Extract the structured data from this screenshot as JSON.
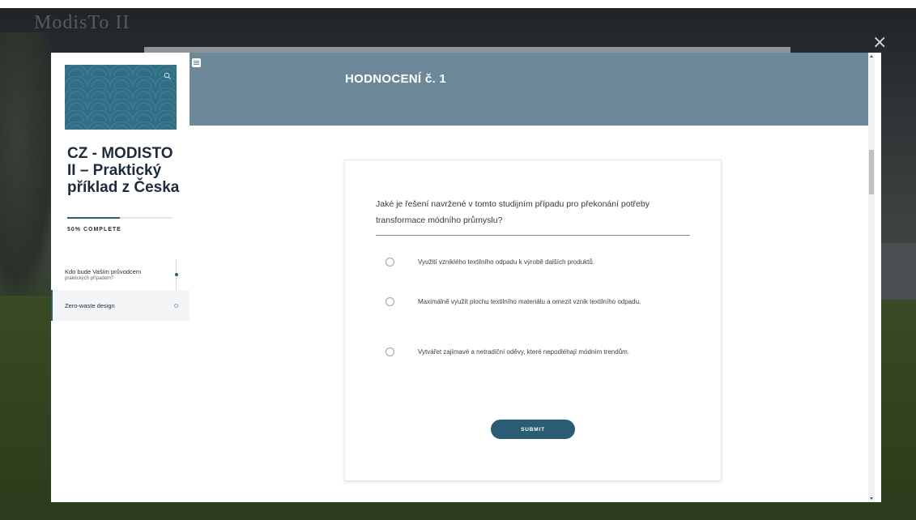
{
  "background": {
    "logo_text": "ModisTo II"
  },
  "window": {
    "close_glyph": "×"
  },
  "sidebar": {
    "course_title": "CZ - MODISTO II – Praktický příklad z Česka",
    "progress_percent": 50,
    "progress_label": "50% COMPLETE",
    "items": [
      {
        "label": "Kdo bude Vaším průvodcem",
        "sublabel": "praktických případem?",
        "status": "complete"
      },
      {
        "label": "Zero-waste design",
        "sublabel": "",
        "status": "current"
      }
    ]
  },
  "header": {
    "title": "HODNOCENÍ č. 1"
  },
  "quiz": {
    "question": "Jaké je řešení navržené v tomto studijním případu pro překonání potřeby transformace módního průmyslu?",
    "options": [
      "Využití vzniklého textilního odpadu k výrobě dalších produktů.",
      "Maximálně využít plochu textilního materiálu a omezit vznik textilního odpadu.",
      "Vytvářet zajímavé a netradiční oděvy, které nepodléhají módním trendům."
    ],
    "submit_label": "SUBMIT"
  },
  "colors": {
    "header_bg": "#6d8898",
    "accent": "#2a5d73",
    "hero_bg": "#2e6f85"
  }
}
